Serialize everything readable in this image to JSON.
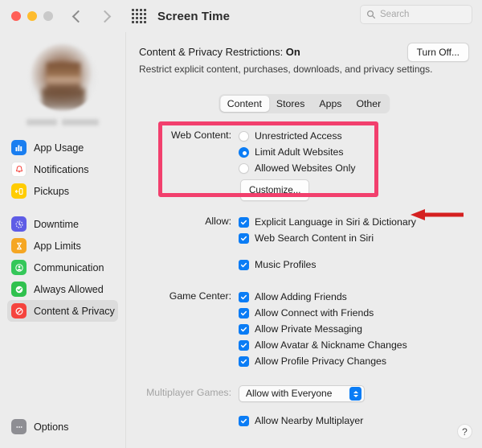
{
  "window": {
    "title": "Screen Time",
    "traffic_lights": [
      "close",
      "minimize",
      "zoom"
    ],
    "nav_back": "back-chevron",
    "nav_forward": "forward-chevron",
    "grid_icon": "grid-apps-icon"
  },
  "search": {
    "placeholder": "Search",
    "icon": "search-icon"
  },
  "sidebar": {
    "profile": {
      "avatar": "user-avatar-blurred",
      "name": ""
    },
    "groups": [
      {
        "items": [
          {
            "label": "App Usage",
            "icon": "bar-chart-icon",
            "icon_class": "ic-appusage",
            "selected": false
          },
          {
            "label": "Notifications",
            "icon": "bell-icon",
            "icon_class": "ic-notifications",
            "selected": false
          },
          {
            "label": "Pickups",
            "icon": "pickups-icon",
            "icon_class": "ic-pickups",
            "selected": false
          }
        ]
      },
      {
        "items": [
          {
            "label": "Downtime",
            "icon": "clock-zzz-icon",
            "icon_class": "ic-downtime",
            "selected": false
          },
          {
            "label": "App Limits",
            "icon": "hourglass-icon",
            "icon_class": "ic-applimits",
            "selected": false
          },
          {
            "label": "Communication",
            "icon": "person-circle-icon",
            "icon_class": "ic-communication",
            "selected": false
          },
          {
            "label": "Always Allowed",
            "icon": "checkmark-badge-icon",
            "icon_class": "ic-allowed",
            "selected": false
          },
          {
            "label": "Content & Privacy",
            "icon": "no-entry-icon",
            "icon_class": "ic-contentprivacy",
            "selected": true
          }
        ]
      }
    ],
    "options": {
      "label": "Options",
      "icon": "ellipsis-icon",
      "icon_class": "ic-options"
    }
  },
  "main": {
    "header": {
      "title_prefix": "Content & Privacy Restrictions: ",
      "title_status": "On",
      "subtitle": "Restrict explicit content, purchases, downloads, and privacy settings.",
      "turn_off_button": "Turn Off..."
    },
    "tabs": [
      {
        "label": "Content",
        "active": true
      },
      {
        "label": "Stores",
        "active": false
      },
      {
        "label": "Apps",
        "active": false
      },
      {
        "label": "Other",
        "active": false
      }
    ],
    "web_content": {
      "label": "Web Content:",
      "options": [
        {
          "label": "Unrestricted Access",
          "selected": false
        },
        {
          "label": "Limit Adult Websites",
          "selected": true
        },
        {
          "label": "Allowed Websites Only",
          "selected": false
        }
      ],
      "customize_button": "Customize..."
    },
    "allow": {
      "label": "Allow:",
      "items": [
        {
          "label": "Explicit Language in Siri & Dictionary",
          "checked": true
        },
        {
          "label": "Web Search Content in Siri",
          "checked": true
        },
        {
          "label": "Music Profiles",
          "checked": true
        }
      ]
    },
    "game_center": {
      "label": "Game Center:",
      "items": [
        {
          "label": "Allow Adding Friends",
          "checked": true
        },
        {
          "label": "Allow Connect with Friends",
          "checked": true
        },
        {
          "label": "Allow Private Messaging",
          "checked": true
        },
        {
          "label": "Allow Avatar & Nickname Changes",
          "checked": true
        },
        {
          "label": "Allow Profile Privacy Changes",
          "checked": true
        }
      ]
    },
    "multiplayer": {
      "label": "Multiplayer Games:",
      "label_disabled": true,
      "selected_option": "Allow with Everyone",
      "nearby": {
        "label": "Allow Nearby Multiplayer",
        "checked": true
      }
    },
    "help_button": "?"
  },
  "annotations": {
    "highlight_box_color": "#f23f6d",
    "arrow_color": "#d52020",
    "arrow_target": "customize-button"
  }
}
